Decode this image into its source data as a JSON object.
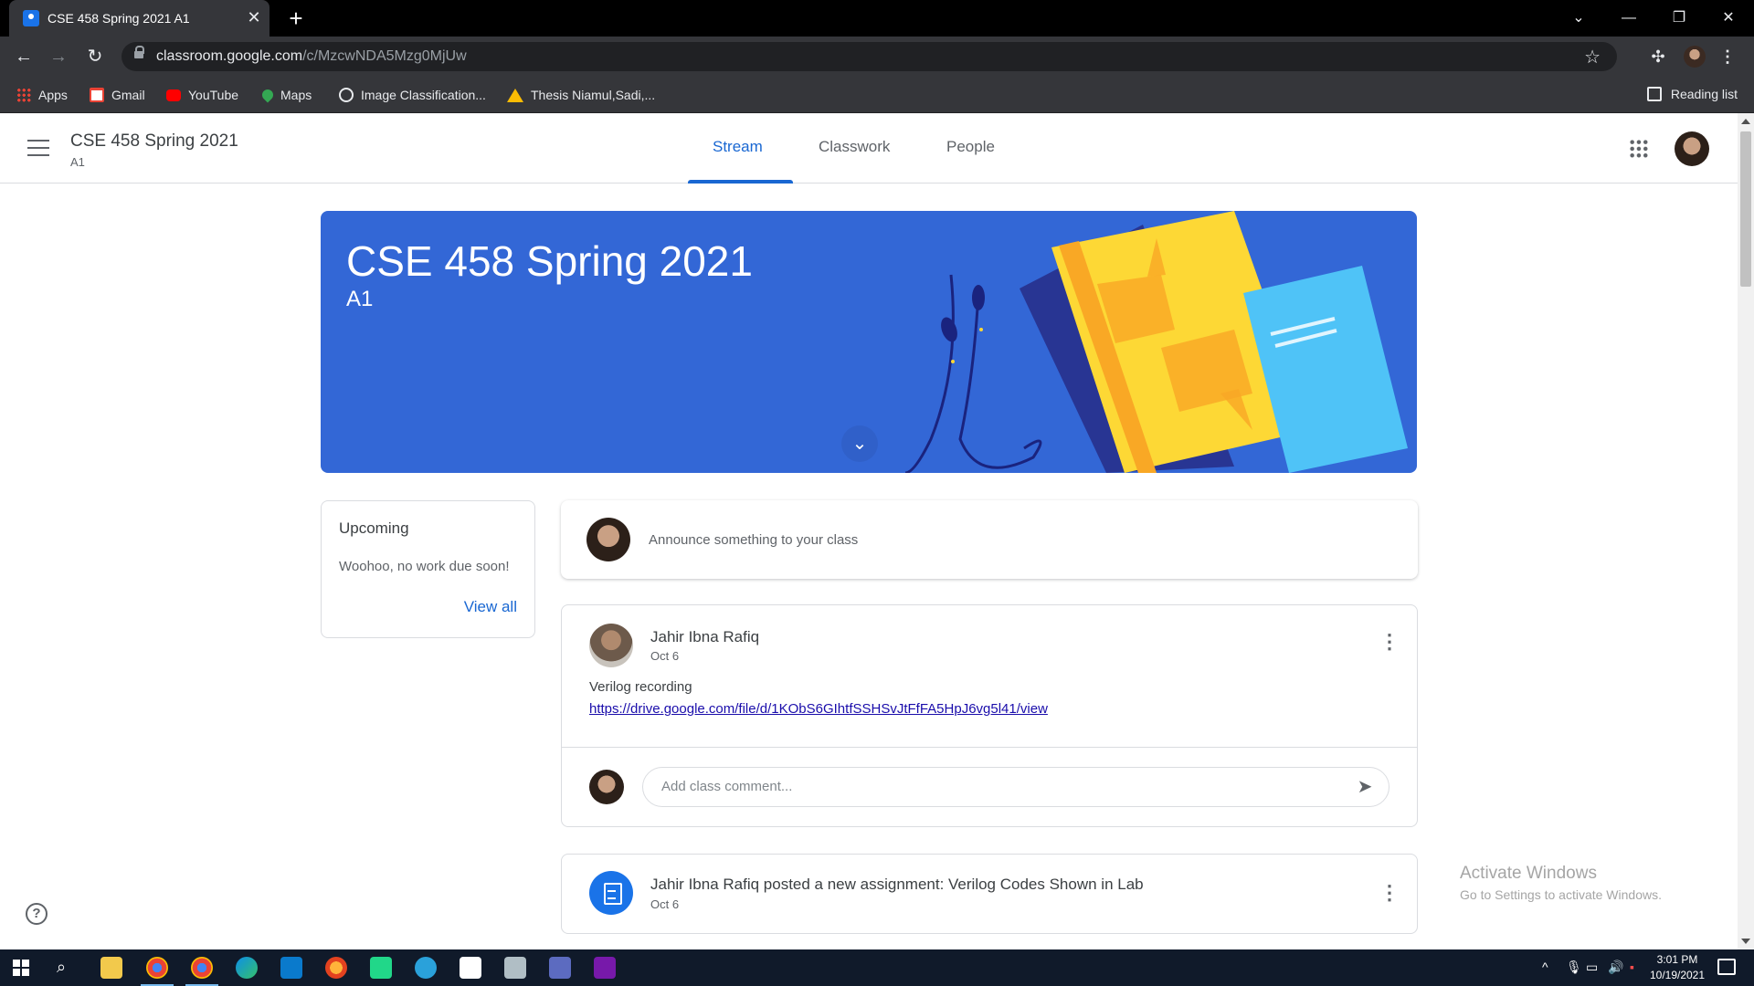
{
  "browser": {
    "tab_title": "CSE 458 Spring 2021 A1",
    "url_host": "classroom.google.com",
    "url_path": "/c/MzcwNDA5Mzg0MjUw",
    "bookmarks": [
      {
        "label": "Apps",
        "icon": "apps-grid-icon"
      },
      {
        "label": "Gmail",
        "icon": "gmail-icon"
      },
      {
        "label": "YouTube",
        "icon": "youtube-icon"
      },
      {
        "label": "Maps",
        "icon": "maps-icon"
      },
      {
        "label": "Image Classification...",
        "icon": "globe-icon"
      },
      {
        "label": "Thesis Niamul,Sadi,...",
        "icon": "drive-icon"
      }
    ],
    "reading_list": "Reading list"
  },
  "classroom": {
    "class_name": "CSE 458 Spring 2021",
    "section": "A1",
    "tabs": [
      "Stream",
      "Classwork",
      "People"
    ],
    "active_tab": "Stream"
  },
  "banner": {
    "title": "CSE 458 Spring 2021",
    "subtitle": "A1"
  },
  "upcoming": {
    "title": "Upcoming",
    "message": "Woohoo, no work due soon!",
    "link": "View all"
  },
  "announce": {
    "placeholder": "Announce something to your class"
  },
  "posts": [
    {
      "author": "Jahir Ibna Rafiq",
      "date": "Oct 6",
      "body": "Verilog recording",
      "link": "https://drive.google.com/file/d/1KObS6GIhtfSSHSvJtFfFA5HpJ6vg5l41/view",
      "comment_placeholder": "Add class comment..."
    }
  ],
  "assignment": {
    "title": "Jahir Ibna Rafiq posted a new assignment: Verilog Codes Shown in Lab",
    "date": "Oct 6"
  },
  "watermark": {
    "line1": "Activate Windows",
    "line2": "Go to Settings to activate Windows."
  },
  "taskbar": {
    "time": "3:01 PM",
    "date": "10/19/2021"
  },
  "colors": {
    "accent": "#1967d2",
    "banner": "#3367d6",
    "book_yellow": "#fdd835",
    "book_lightblue": "#4fc3f7"
  }
}
